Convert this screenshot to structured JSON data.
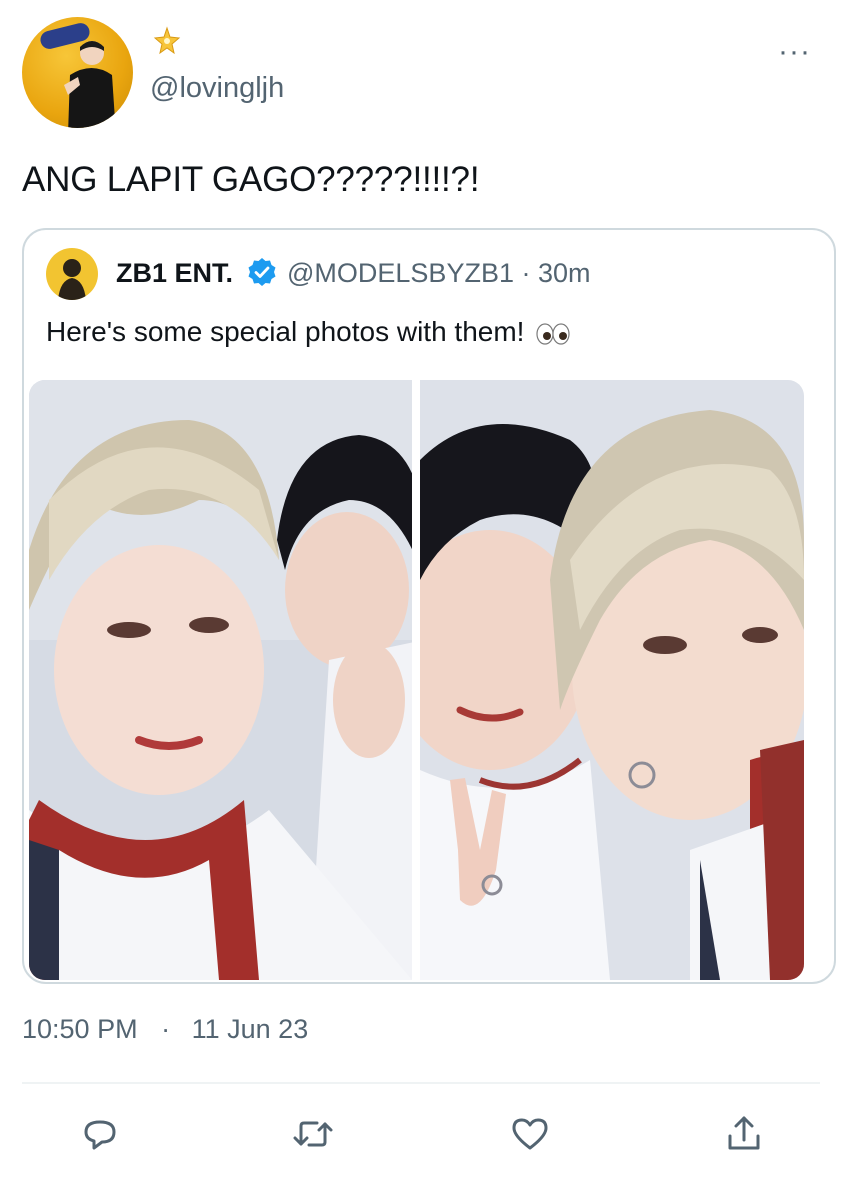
{
  "tweet": {
    "username": "@lovingljh",
    "text": "ANG LAPIT GAGO?????!!!!?!",
    "timestamp": "10:50 PM",
    "separator": "·",
    "date": "11 Jun 23"
  },
  "quoted_tweet": {
    "display_name": "ZB1 ENT.",
    "handle_time": "@MODELSBYZB1 · 30m",
    "text": "Here's some special photos with them!",
    "emoji": "eyes-emoji"
  },
  "icons": {
    "more": "more-icon",
    "badge": "sparkle-badge-icon",
    "verified": "verified-icon",
    "reply": "reply-icon",
    "retweet": "retweet-icon",
    "like": "like-icon",
    "share": "share-icon"
  },
  "colors": {
    "text_primary": "#0f1419",
    "text_secondary": "#536471",
    "verified_blue": "#1d9bf0",
    "border": "#cfd9de"
  }
}
